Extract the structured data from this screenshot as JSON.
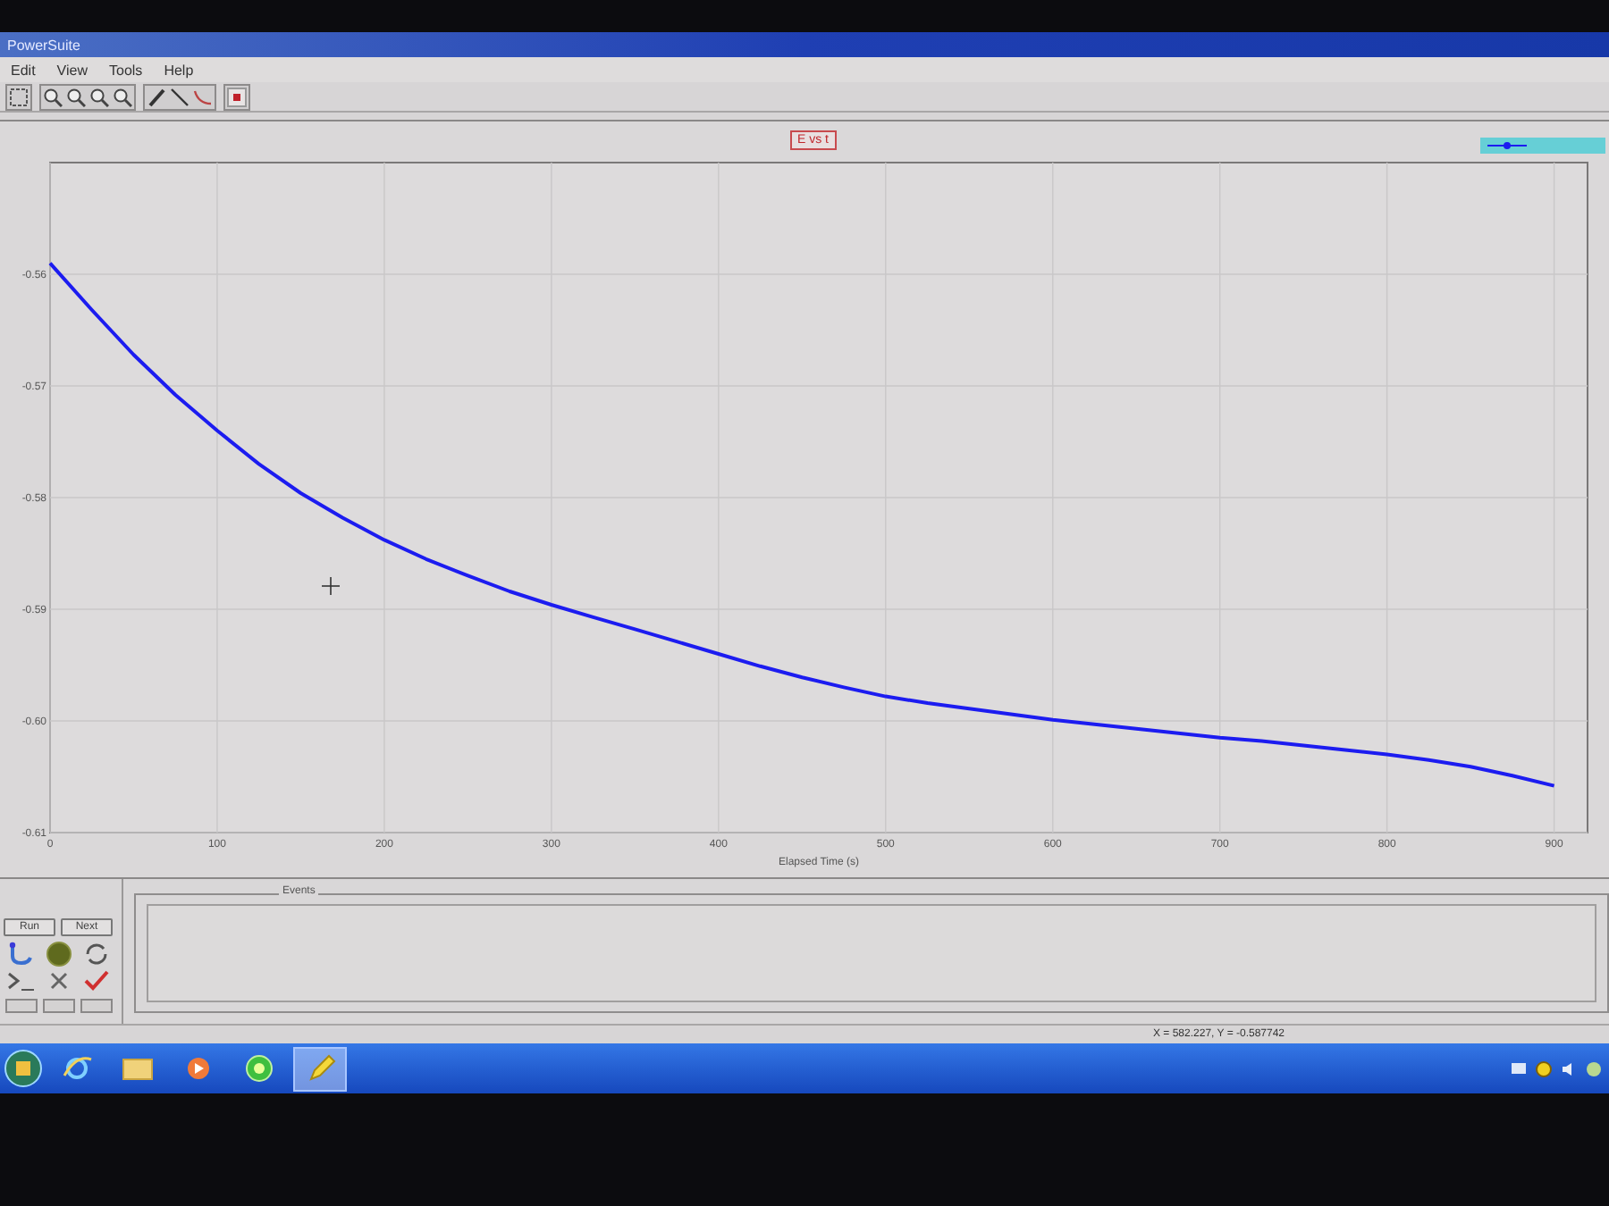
{
  "window": {
    "title": "PowerSuite"
  },
  "menu": [
    {
      "label": "Edit"
    },
    {
      "label": "View"
    },
    {
      "label": "Tools"
    },
    {
      "label": "Help"
    }
  ],
  "chart": {
    "chart_data": {
      "type": "line",
      "title": "E vs t",
      "xlabel": "Elapsed Time (s)",
      "x": [
        0,
        25,
        50,
        75,
        100,
        125,
        150,
        175,
        200,
        225,
        250,
        275,
        300,
        325,
        350,
        375,
        400,
        425,
        450,
        475,
        500,
        525,
        550,
        575,
        600,
        625,
        650,
        675,
        700,
        725,
        750,
        775,
        800,
        825,
        850,
        875,
        900
      ],
      "series": [
        {
          "color": "#1c1cf0",
          "values": [
            -0.559,
            -0.5632,
            -0.5672,
            -0.5708,
            -0.574,
            -0.577,
            -0.5796,
            -0.5818,
            -0.5838,
            -0.5855,
            -0.587,
            -0.5884,
            -0.5896,
            -0.5907,
            -0.5918,
            -0.5929,
            -0.594,
            -0.5951,
            -0.5961,
            -0.597,
            -0.5978,
            -0.5984,
            -0.5989,
            -0.5994,
            -0.5999,
            -0.6003,
            -0.6007,
            -0.6011,
            -0.6015,
            -0.6018,
            -0.6022,
            -0.6026,
            -0.603,
            -0.6035,
            -0.6041,
            -0.6049,
            -0.6058
          ]
        }
      ],
      "xlim": [
        0,
        920
      ],
      "ylim": [
        -0.61,
        -0.55
      ],
      "xticks": [
        0,
        100,
        200,
        300,
        400,
        500,
        600,
        700,
        800,
        900
      ],
      "yticks": [
        {
          "value": -0.56,
          "label": "-0.56"
        },
        {
          "value": -0.57,
          "label": "-0.57"
        },
        {
          "value": -0.58,
          "label": "-0.58"
        },
        {
          "value": -0.59,
          "label": "-0.59"
        },
        {
          "value": -0.6,
          "label": "-0.60"
        },
        {
          "value": -0.61,
          "label": "-0.61"
        }
      ],
      "grid": true
    }
  },
  "control_panel": {
    "buttons": [
      {
        "label": "Run"
      },
      {
        "label": "Next"
      }
    ]
  },
  "log_panel": {
    "title": "Events"
  },
  "status_bar": {
    "readout": "X = 582.227, Y = -0.587742"
  },
  "taskbar": {
    "items": [
      {
        "kind": "browser",
        "selected": false
      },
      {
        "kind": "folder",
        "selected": false
      },
      {
        "kind": "player",
        "selected": false
      },
      {
        "kind": "chat",
        "selected": false
      },
      {
        "kind": "pencil",
        "selected": true
      }
    ]
  }
}
